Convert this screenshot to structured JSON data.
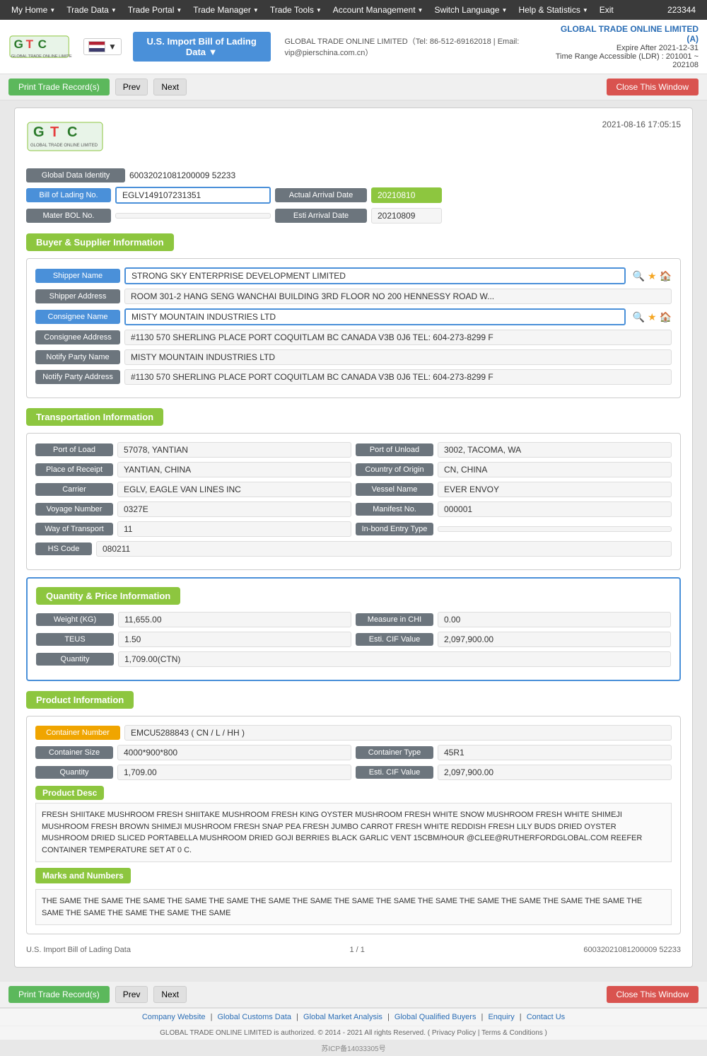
{
  "topNav": {
    "items": [
      "My Home",
      "Trade Data",
      "Trade Portal",
      "Trade Manager",
      "Trade Tools",
      "Account Management",
      "Switch Language",
      "Help & Statistics",
      "Exit"
    ],
    "accountNum": "223344"
  },
  "header": {
    "companyLine": "GLOBAL TRADE ONLINE LIMITED（Tel: 86-512-69162018 | Email: vip@pierschina.com.cn）",
    "accountCompany": "GLOBAL TRADE ONLINE LIMITED (A)",
    "expireAfter": "Expire After 2021-12-31",
    "timeRange": "Time Range Accessible (LDR) : 201001 ~ 202108",
    "dbSelector": "U.S. Import Bill of Lading Data ▼"
  },
  "actionBar": {
    "printBtn": "Print Trade Record(s)",
    "prevBtn": "Prev",
    "nextBtn": "Next",
    "closeBtn": "Close This Window"
  },
  "record": {
    "date": "2021-08-16 17:05:15",
    "globalDataIdentity": {
      "label": "Global Data Identity",
      "value": "60032021081200009 52233"
    },
    "billOfLading": {
      "label": "Bill of Lading No.",
      "value": "EGLV149107231351"
    },
    "actualArrivalDate": {
      "label": "Actual Arrival Date",
      "value": "20210810"
    },
    "materBOL": {
      "label": "Mater BOL No.",
      "value": ""
    },
    "estiArrivalDate": {
      "label": "Esti Arrival Date",
      "value": "20210809"
    }
  },
  "buyerSupplier": {
    "sectionTitle": "Buyer & Supplier Information",
    "shipperName": {
      "label": "Shipper Name",
      "value": "STRONG SKY ENTERPRISE DEVELOPMENT LIMITED"
    },
    "shipperAddress": {
      "label": "Shipper Address",
      "value": "ROOM 301-2 HANG SENG WANCHAI BUILDING 3RD FLOOR NO 200 HENNESSY ROAD W..."
    },
    "consigneeName": {
      "label": "Consignee Name",
      "value": "MISTY MOUNTAIN INDUSTRIES LTD"
    },
    "consigneeAddress": {
      "label": "Consignee Address",
      "value": "#1130 570 SHERLING PLACE PORT COQUITLAM BC CANADA V3B 0J6 TEL: 604-273-8299 F"
    },
    "notifyPartyName": {
      "label": "Notify Party Name",
      "value": "MISTY MOUNTAIN INDUSTRIES LTD"
    },
    "notifyPartyAddress": {
      "label": "Notify Party Address",
      "value": "#1130 570 SHERLING PLACE PORT COQUITLAM BC CANADA V3B 0J6 TEL: 604-273-8299 F"
    }
  },
  "transportation": {
    "sectionTitle": "Transportation Information",
    "portOfLoad": {
      "label": "Port of Load",
      "value": "57078, YANTIAN"
    },
    "portOfUnload": {
      "label": "Port of Unload",
      "value": "3002, TACOMA, WA"
    },
    "placeOfReceipt": {
      "label": "Place of Receipt",
      "value": "YANTIAN, CHINA"
    },
    "countryOfOrigin": {
      "label": "Country of Origin",
      "value": "CN, CHINA"
    },
    "carrier": {
      "label": "Carrier",
      "value": "EGLV, EAGLE VAN LINES INC"
    },
    "vesselName": {
      "label": "Vessel Name",
      "value": "EVER ENVOY"
    },
    "voyageNumber": {
      "label": "Voyage Number",
      "value": "0327E"
    },
    "manifestNo": {
      "label": "Manifest No.",
      "value": "000001"
    },
    "wayOfTransport": {
      "label": "Way of Transport",
      "value": "11"
    },
    "inBondEntryType": {
      "label": "In-bond Entry Type",
      "value": ""
    },
    "hsCode": {
      "label": "HS Code",
      "value": "080211"
    }
  },
  "quantityPrice": {
    "sectionTitle": "Quantity & Price Information",
    "weightKG": {
      "label": "Weight (KG)",
      "value": "11,655.00"
    },
    "measureInChi": {
      "label": "Measure in CHI",
      "value": "0.00"
    },
    "teus": {
      "label": "TEUS",
      "value": "1.50"
    },
    "estiCIFValue": {
      "label": "Esti. CIF Value",
      "value": "2,097,900.00"
    },
    "quantity": {
      "label": "Quantity",
      "value": "1,709.00(CTN)"
    }
  },
  "productInfo": {
    "sectionTitle": "Product Information",
    "containerNumber": {
      "label": "Container Number",
      "value": "EMCU5288843 ( CN / L / HH )"
    },
    "containerSize": {
      "label": "Container Size",
      "value": "4000*900*800"
    },
    "containerType": {
      "label": "Container Type",
      "value": "45R1"
    },
    "quantity": {
      "label": "Quantity",
      "value": "1,709.00"
    },
    "estiCIFValue": {
      "label": "Esti. CIF Value",
      "value": "2,097,900.00"
    },
    "productDescLabel": "Product Desc",
    "productDesc": "FRESH SHIITAKE MUSHROOM FRESH SHIITAKE MUSHROOM FRESH KING OYSTER MUSHROOM FRESH WHITE SNOW MUSHROOM FRESH WHITE SHIMEJI MUSHROOM FRESH BROWN SHIMEJI MUSHROOM FRESH SNAP PEA FRESH JUMBO CARROT FRESH WHITE REDDISH FRESH LILY BUDS DRIED OYSTER MUSHROOM DRIED SLICED PORTABELLA MUSHROOM DRIED GOJI BERRIES BLACK GARLIC VENT 15CBM/HOUR @CLEE@RUTHERFORDGLOBAL.COM REEFER CONTAINER TEMPERATURE SET AT 0 C.",
    "marksLabel": "Marks and Numbers",
    "marksValue": "THE SAME THE SAME THE SAME THE SAME THE SAME THE SAME THE SAME THE SAME THE SAME THE SAME THE SAME THE SAME THE SAME THE SAME THE SAME THE SAME THE SAME THE SAME THE SAME"
  },
  "pageInfo": {
    "dbLabel": "U.S. Import Bill of Lading Data",
    "pageNum": "1 / 1",
    "recordId": "60032021081200009 52233"
  },
  "footer": {
    "links": [
      "Company Website",
      "Global Customs Data",
      "Global Market Analysis",
      "Global Qualified Buyers",
      "Enquiry",
      "Contact Us"
    ],
    "copyright": "GLOBAL TRADE ONLINE LIMITED is authorized. © 2014 - 2021 All rights Reserved.  ( Privacy Policy | Terms & Conditions )",
    "icp": "苏ICP备14033305号"
  }
}
